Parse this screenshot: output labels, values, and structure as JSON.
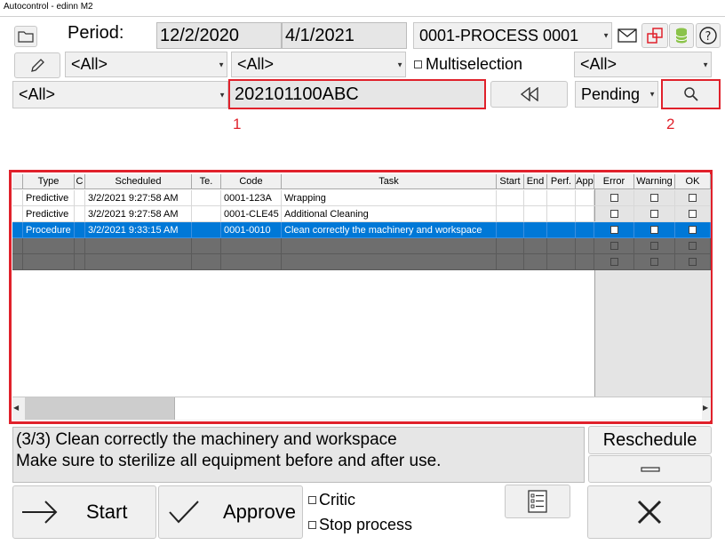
{
  "window": {
    "title": "Autocontrol - edinn M2"
  },
  "filters": {
    "period_label": "Period:",
    "date_from": "12/2/2020",
    "date_to": "4/1/2021",
    "process": "0001-PROCESS 0001",
    "combo1": "<All>",
    "combo2": "<All>",
    "combo3": "<All>",
    "combo4": "<All>",
    "multiselection_label": "Multiselection",
    "search_text": "202101100ABC",
    "status": "Pending"
  },
  "annotations": {
    "label1": "1",
    "label2": "2"
  },
  "table": {
    "columns": [
      "Type",
      "C",
      "Scheduled",
      "Te.",
      "Code",
      "Task",
      "Start",
      "End",
      "Perf.",
      "App"
    ],
    "flag_columns": [
      "Error",
      "Warning",
      "OK"
    ],
    "rows": [
      {
        "type": "Predictive",
        "c": "",
        "scheduled": "3/2/2021 9:27:58 AM",
        "te": "",
        "code": "0001-123A",
        "task": "Wrapping"
      },
      {
        "type": "Predictive",
        "c": "",
        "scheduled": "3/2/2021 9:27:58 AM",
        "te": "",
        "code": "0001-CLE45",
        "task": "Additional Cleaning"
      },
      {
        "type": "Procedure",
        "c": "",
        "scheduled": "3/2/2021 9:33:15 AM",
        "te": "",
        "code": "0001-0010",
        "task": "Clean correctly the machinery and workspace"
      }
    ],
    "selected_row": 2
  },
  "details": {
    "line1": "(3/3) Clean correctly the machinery and workspace",
    "line2": "Make sure to sterilize all equipment before and after use."
  },
  "actions": {
    "reschedule_label": "Reschedule",
    "start_label": "Start",
    "approve_label": "Approve",
    "critic_label": "Critic",
    "stop_process_label": "Stop process"
  },
  "colors": {
    "highlight": "#e0212b",
    "selection": "#0078d7"
  }
}
